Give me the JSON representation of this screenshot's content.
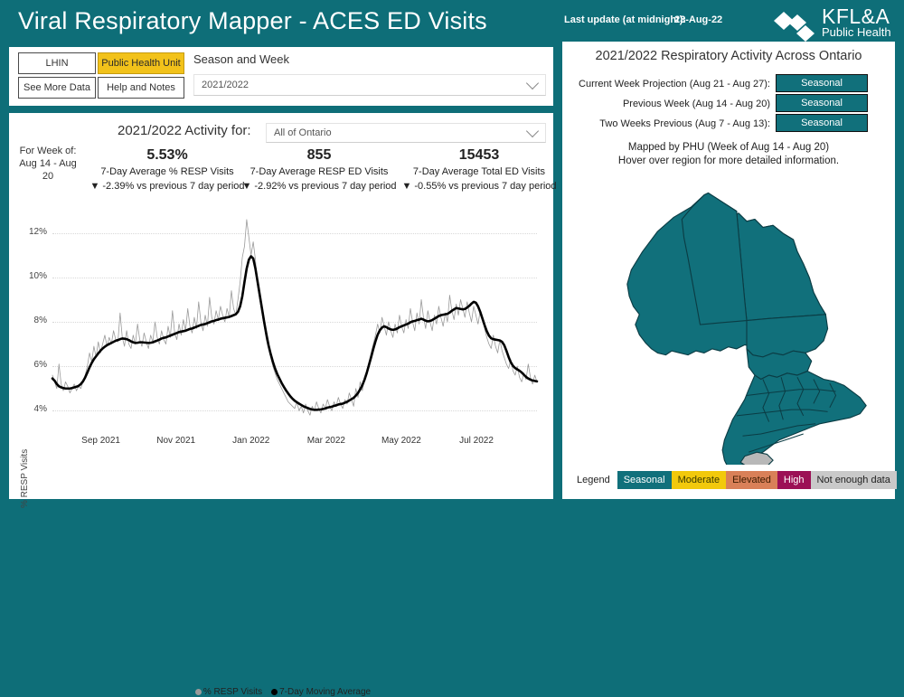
{
  "header": {
    "title": "Viral Respiratory Mapper - ACES ED Visits",
    "last_update_label": "Last update (at midnight):",
    "last_update_value": "23-Aug-22",
    "logo_primary": "KFL&A",
    "logo_secondary": "Public Health"
  },
  "controls": {
    "btn_lhin": "LHIN",
    "btn_phu": "Public Health Unit",
    "btn_more_data": "See More Data",
    "btn_help": "Help and Notes",
    "season_label": "Season and Week",
    "season_value": "2021/2022"
  },
  "chart_panel": {
    "activity_for_label": "2021/2022 Activity for:",
    "region_value": "All of Ontario",
    "week_label": "For Week of: Aug 14 - Aug 20",
    "kpis": [
      {
        "value": "5.53%",
        "name": "7-Day Average % RESP Visits",
        "delta": "▼ -2.39% vs previous 7 day period"
      },
      {
        "value": "855",
        "name": "7-Day Average RESP ED Visits",
        "delta": "▼ -2.92% vs previous 7 day period"
      },
      {
        "value": "15453",
        "name": "7-Day Average Total ED Visits",
        "delta": "▼ -0.55% vs previous 7 day period"
      }
    ],
    "legend": {
      "series_daily": "% RESP Visits",
      "series_avg": "7-Day Moving Average",
      "color_daily": "#9a9a9a",
      "color_avg": "#000000"
    }
  },
  "chart_data": {
    "type": "line",
    "title": "",
    "xlabel": "",
    "ylabel": "% RESP Visits",
    "ylim": [
      3.2,
      12.8
    ],
    "yticks": [
      "4%",
      "6%",
      "8%",
      "10%",
      "12%"
    ],
    "ytick_values": [
      4,
      6,
      8,
      10,
      12
    ],
    "xticks": [
      "Sep 2021",
      "Nov 2021",
      "Jan 2022",
      "Mar 2022",
      "May 2022",
      "Jul 2022"
    ],
    "xtick_positions": [
      0.1,
      0.255,
      0.41,
      0.565,
      0.72,
      0.875
    ],
    "grid": true,
    "legend_position": "bottom",
    "series": [
      {
        "name": "% RESP Visits",
        "color": "#9a9a9a",
        "values": [
          5.6,
          5.3,
          5.0,
          6.1,
          5.2,
          4.9,
          5.3,
          5.1,
          4.8,
          5.0,
          5.2,
          4.9,
          5.1,
          5.0,
          5.3,
          5.6,
          6.0,
          6.6,
          6.2,
          6.9,
          6.4,
          7.1,
          6.6,
          7.0,
          7.4,
          6.9,
          7.3,
          7.0,
          7.6,
          7.2,
          7.1,
          8.4,
          7.3,
          6.9,
          7.6,
          7.0,
          6.8,
          7.4,
          7.0,
          7.9,
          7.2,
          6.9,
          7.5,
          7.1,
          6.8,
          7.4,
          7.1,
          8.0,
          7.3,
          7.0,
          7.6,
          7.2,
          7.0,
          7.8,
          7.3,
          8.5,
          7.5,
          7.2,
          7.9,
          7.4,
          8.1,
          7.6,
          8.6,
          7.8,
          7.5,
          8.2,
          7.7,
          8.9,
          8.0,
          7.6,
          8.3,
          7.8,
          9.1,
          8.2,
          7.9,
          8.5,
          8.1,
          8.7,
          8.3,
          8.0,
          8.6,
          8.2,
          9.4,
          8.6,
          8.3,
          9.0,
          9.8,
          10.9,
          11.4,
          12.6,
          11.8,
          11.0,
          11.6,
          10.8,
          9.6,
          9.0,
          8.4,
          7.8,
          7.2,
          6.8,
          6.4,
          6.0,
          5.7,
          5.4,
          5.2,
          5.0,
          4.8,
          4.6,
          4.4,
          4.3,
          4.2,
          4.1,
          4.4,
          4.0,
          4.2,
          3.9,
          4.3,
          4.0,
          3.8,
          4.2,
          4.0,
          4.4,
          4.1,
          3.9,
          4.3,
          4.1,
          4.5,
          4.2,
          4.0,
          4.4,
          4.2,
          4.6,
          4.3,
          4.1,
          4.5,
          4.3,
          4.8,
          4.5,
          4.2,
          5.0,
          4.6,
          5.3,
          4.9,
          5.5,
          5.8,
          6.2,
          6.6,
          7.0,
          7.4,
          7.9,
          7.5,
          8.2,
          7.8,
          7.4,
          8.0,
          7.6,
          7.3,
          7.9,
          7.5,
          8.3,
          7.8,
          7.5,
          8.1,
          7.7,
          8.6,
          8.0,
          7.6,
          8.4,
          7.9,
          9.0,
          8.2,
          7.7,
          8.5,
          8.0,
          7.6,
          8.3,
          7.9,
          8.7,
          8.2,
          7.8,
          8.4,
          8.0,
          9.2,
          8.5,
          8.1,
          8.8,
          8.3,
          9.0,
          8.6,
          8.2,
          8.9,
          8.4,
          8.0,
          8.7,
          8.3,
          7.9,
          8.5,
          8.1,
          7.7,
          7.3,
          7.0,
          6.8,
          7.4,
          6.9,
          6.6,
          7.2,
          6.7,
          6.4,
          6.1,
          5.9,
          6.3,
          5.8,
          5.6,
          6.0,
          5.5,
          5.3,
          5.7,
          5.4,
          6.1,
          5.5,
          5.2,
          5.6,
          5.3
        ]
      },
      {
        "name": "7-Day Moving Average",
        "color": "#000000",
        "values": [
          5.45,
          5.35,
          5.2,
          5.1,
          5.05,
          5.02,
          5.0,
          5.0,
          5.0,
          5.02,
          5.05,
          5.08,
          5.12,
          5.2,
          5.32,
          5.5,
          5.72,
          5.95,
          6.15,
          6.32,
          6.45,
          6.58,
          6.7,
          6.8,
          6.88,
          6.95,
          7.0,
          7.05,
          7.1,
          7.15,
          7.18,
          7.22,
          7.25,
          7.24,
          7.22,
          7.18,
          7.12,
          7.08,
          7.05,
          7.06,
          7.08,
          7.08,
          7.07,
          7.06,
          7.05,
          7.06,
          7.08,
          7.12,
          7.16,
          7.2,
          7.25,
          7.28,
          7.3,
          7.34,
          7.38,
          7.42,
          7.46,
          7.5,
          7.54,
          7.56,
          7.58,
          7.6,
          7.64,
          7.68,
          7.7,
          7.74,
          7.78,
          7.82,
          7.86,
          7.88,
          7.9,
          7.94,
          7.98,
          8.02,
          8.04,
          8.08,
          8.1,
          8.14,
          8.16,
          8.18,
          8.2,
          8.22,
          8.26,
          8.3,
          8.34,
          8.45,
          8.7,
          9.15,
          9.8,
          10.4,
          10.8,
          10.95,
          10.85,
          10.4,
          9.8,
          9.2,
          8.6,
          8.0,
          7.45,
          6.95,
          6.55,
          6.2,
          5.9,
          5.65,
          5.45,
          5.25,
          5.08,
          4.92,
          4.78,
          4.65,
          4.54,
          4.45,
          4.38,
          4.32,
          4.26,
          4.2,
          4.16,
          4.12,
          4.08,
          4.06,
          4.04,
          4.04,
          4.05,
          4.06,
          4.08,
          4.1,
          4.14,
          4.16,
          4.18,
          4.22,
          4.24,
          4.28,
          4.3,
          4.32,
          4.36,
          4.4,
          4.46,
          4.52,
          4.58,
          4.68,
          4.8,
          4.96,
          5.15,
          5.4,
          5.7,
          6.05,
          6.4,
          6.78,
          7.12,
          7.42,
          7.62,
          7.74,
          7.8,
          7.76,
          7.7,
          7.66,
          7.64,
          7.66,
          7.7,
          7.76,
          7.8,
          7.84,
          7.88,
          7.92,
          7.98,
          8.02,
          8.04,
          8.08,
          8.1,
          8.14,
          8.1,
          8.05,
          8.02,
          8.04,
          8.08,
          8.14,
          8.2,
          8.26,
          8.3,
          8.32,
          8.34,
          8.36,
          8.42,
          8.5,
          8.56,
          8.62,
          8.6,
          8.58,
          8.56,
          8.58,
          8.64,
          8.72,
          8.82,
          8.9,
          8.86,
          8.7,
          8.45,
          8.15,
          7.85,
          7.58,
          7.38,
          7.26,
          7.22,
          7.2,
          7.18,
          7.16,
          7.1,
          6.95,
          6.7,
          6.42,
          6.18,
          6.02,
          5.92,
          5.86,
          5.8,
          5.72,
          5.62,
          5.52,
          5.45,
          5.4,
          5.36,
          5.34,
          5.32
        ]
      }
    ]
  },
  "right_panel": {
    "title": "2021/2022 Respiratory Activity Across Ontario",
    "activity_rows": [
      {
        "label": "Current Week Projection (Aug 21 - Aug 27):",
        "status": "Seasonal",
        "color": "#11707b"
      },
      {
        "label": "Previous Week (Aug 14 - Aug 20)",
        "status": "Seasonal",
        "color": "#11707b"
      },
      {
        "label": "Two Weeks Previous (Aug 7 - Aug 13):",
        "status": "Seasonal",
        "color": "#11707b"
      }
    ],
    "map_caption_line1": "Mapped by PHU (Week of Aug 14 - Aug 20)",
    "map_caption_line2": "Hover over region for more detailed information.",
    "legend_word": "Legend",
    "legend_items": [
      {
        "label": "Seasonal",
        "color": "#11707b",
        "text_color": "#ffffff"
      },
      {
        "label": "Moderate",
        "color": "#f2c90c",
        "text_color": "#3a3a00"
      },
      {
        "label": "Elevated",
        "color": "#d98058",
        "text_color": "#3a1a00"
      },
      {
        "label": "High",
        "color": "#9c1055",
        "text_color": "#ffffff"
      },
      {
        "label": "Not enough data",
        "color": "#c9c9c9",
        "text_color": "#222222"
      }
    ],
    "map": {
      "default_region_color": "#11707b",
      "no_data_region_color": "#b8b8b8",
      "border_color": "#0b3c44"
    }
  },
  "theme": {
    "background_teal": "#0e6e78",
    "panel_white": "#ffffff",
    "accent_gold": "#f2c21a"
  }
}
